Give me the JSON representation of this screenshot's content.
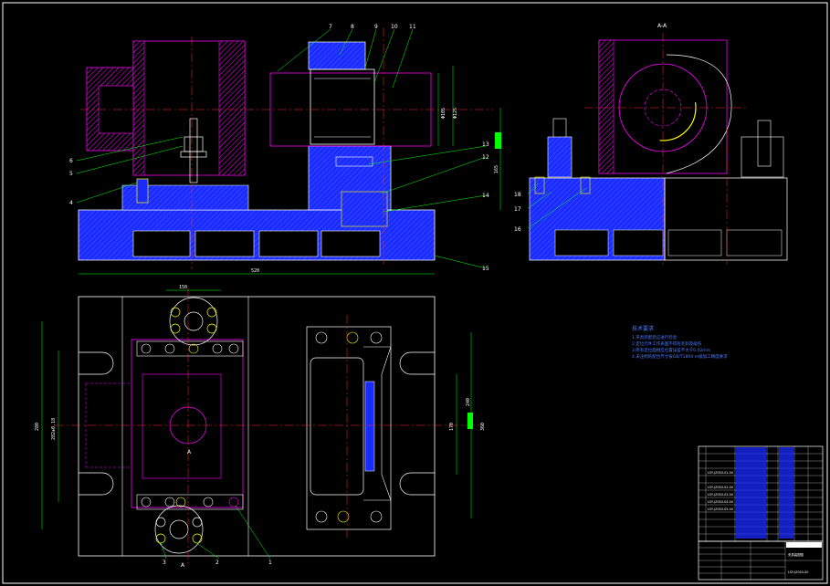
{
  "section_title": "A-A",
  "part_numbers": [
    "1",
    "2",
    "3",
    "4",
    "5",
    "6",
    "7",
    "8",
    "9",
    "10",
    "11",
    "12",
    "13",
    "14",
    "15",
    "16",
    "17",
    "18"
  ],
  "dimensions": {
    "overall_length": "520",
    "plan_width": "360",
    "plan_length": "280",
    "plan_mid_a": "170",
    "plan_mid_b": "240",
    "plan_left_b": "282±0.18",
    "top_width": "150",
    "elev_height": "165",
    "shaft_dia_a": "Φ105",
    "shaft_dia_b": "Φ125"
  },
  "section_mark": "A",
  "tech_notes_title": "技术要求",
  "tech_notes": [
    "1.夹具装配后应进行检验",
    "2.定位元件工作表面不得有毛刺及碰伤",
    "3.所有定位面相互位置误差不大于0.02mm",
    "4.未注明的配合尺寸按GB/T1804-m级加工精度要求"
  ],
  "title_block": {
    "drawing_no": "LSY-JZ003-00",
    "title": "夹具装配图",
    "rows": [
      "LSY-JZ003-01-00",
      "LSY-JZ003-02-00",
      "LSY-JZ003-03-00",
      "LSY-JZ003-04-00",
      "LSY-JZ003-05-00"
    ]
  },
  "colors": {
    "outline": "#ffffff",
    "hatch_blue": "#1a2bff",
    "magenta": "#ff00ff",
    "center_red": "#ff2a2a",
    "dim_green": "#00ff00",
    "yellow": "#ffff00"
  }
}
